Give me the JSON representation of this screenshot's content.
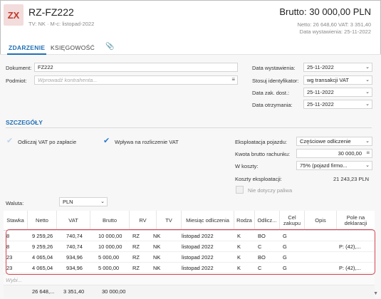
{
  "header": {
    "logo": "ZX",
    "title": "RZ-FZ222",
    "subtitle": "TV: NK  ·  M-c: listopad-2022",
    "gross": "Brutto: 30 000,00 PLN",
    "net_vat": "Netto: 26 648,60 VAT: 3 351,40",
    "issue_date": "Data wystawienia: 25-11-2022"
  },
  "tabs": {
    "event": "ZDARZENIE",
    "accounting": "KSIĘGOWOŚĆ",
    "attachment_icon": "paperclip-icon"
  },
  "form": {
    "document_label": "Dokument:",
    "document_value": "FZ222",
    "contractor_label": "Podmiot:",
    "contractor_placeholder": "Wprowadź kontrahenta...",
    "issue_date_label": "Data wystawienia:",
    "issue_date_value": "25-11-2022",
    "identifier_label": "Stosuj identyfikator:",
    "identifier_value": "wg transakcji VAT",
    "delivery_date_label": "Data zak. dost.:",
    "delivery_date_value": "25-11-2022",
    "receipt_date_label": "Data otrzymania:",
    "receipt_date_value": "25-11-2022"
  },
  "details": {
    "title": "SZCZEGÓŁY",
    "vat_after_payment": "Odliczaj VAT po zapłacie",
    "affects_vat": "Wpływa na rozliczenie VAT",
    "vehicle_label": "Eksploatacja pojazdu:",
    "vehicle_value": "Częściowe odliczenie",
    "gross_amount_label": "Kwota brutto rachunku:",
    "gross_amount_value": "30 000,00",
    "costs_label": "W koszty:",
    "costs_value": "75% (pojazd firmo...",
    "operating_costs_label": "Koszty eksploatacji:",
    "operating_costs_value": "21 243,23 PLN",
    "no_fuel_label": "Nie dotyczy paliwa",
    "currency_label": "Waluta:",
    "currency_value": "PLN"
  },
  "table": {
    "headers": [
      "Stawka",
      "Netto",
      "VAT",
      "Brutto",
      "RV",
      "TV",
      "Miesiąc odliczenia",
      "Rodza",
      "Odlicz...",
      "Cel zakupu",
      "Opis",
      "Pole na deklaracji"
    ],
    "rows": [
      [
        "8",
        "9 259,26",
        "740,74",
        "10 000,00",
        "RZ",
        "NK",
        "listopad 2022",
        "K",
        "BO",
        "G",
        "",
        ""
      ],
      [
        "8",
        "9 259,26",
        "740,74",
        "10 000,00",
        "RZ",
        "NK",
        "listopad 2022",
        "K",
        "C",
        "G",
        "",
        "P: (42),..."
      ],
      [
        "23",
        "4 065,04",
        "934,96",
        "5 000,00",
        "RZ",
        "NK",
        "listopad 2022",
        "K",
        "BO",
        "G",
        "",
        ""
      ],
      [
        "23",
        "4 065,04",
        "934,96",
        "5 000,00",
        "RZ",
        "NK",
        "listopad 2022",
        "K",
        "C",
        "G",
        "",
        "P: (42),..."
      ]
    ],
    "new_row_placeholder": "Wybi...",
    "totals": [
      "26 648,...",
      "3 351,40",
      "30 000,00"
    ]
  },
  "colors": {
    "accent": "#1f6fb5",
    "logo_bg": "#f3dcdc",
    "logo_fg": "#c0392b",
    "selection": "#d9434f"
  }
}
